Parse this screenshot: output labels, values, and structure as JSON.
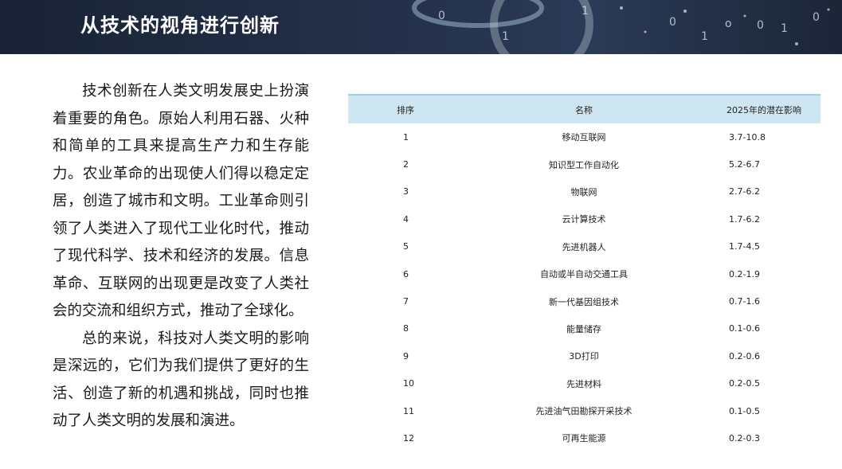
{
  "banner": {
    "title": "从技术的视角进行创新"
  },
  "text": {
    "paragraphs": [
      "技术创新在人类文明发展史上扮演着重要的角色。原始人利用石器、火种和简单的工具来提高生产力和生存能力。农业革命的出现使人们得以稳定定居，创造了城市和文明。工业革命则引领了人类进入了现代工业化时代，推动了现代科学、技术和经济的发展。信息革命、互联网的出现更是改变了人类社会的交流和组织方式，推动了全球化。",
      "总的来说，科技对人类文明的影响是深远的，它们为我们提供了更好的生活、创造了新的机遇和挑战，同时也推动了人类文明的发展和演进。"
    ]
  },
  "table": {
    "headers": [
      "排序",
      "名称",
      "2025年的潜在影响"
    ],
    "rows": [
      [
        "1",
        "移动互联网",
        "3.7-10.8"
      ],
      [
        "2",
        "知识型工作自动化",
        "5.2-6.7"
      ],
      [
        "3",
        "物联网",
        "2.7-6.2"
      ],
      [
        "4",
        "云计算技术",
        "1.7-6.2"
      ],
      [
        "5",
        "先进机器人",
        "1.7-4.5"
      ],
      [
        "6",
        "自动或半自动交通工具",
        "0.2-1.9"
      ],
      [
        "7",
        "新一代基因组技术",
        "0.7-1.6"
      ],
      [
        "8",
        "能量储存",
        "0.1-0.6"
      ],
      [
        "9",
        "3D打印",
        "0.2-0.6"
      ],
      [
        "10",
        "先进材料",
        "0.2-0.5"
      ],
      [
        "11",
        "先进油气田勘探开采技术",
        "0.1-0.5"
      ],
      [
        "12",
        "可再生能源",
        "0.2-0.3"
      ]
    ]
  }
}
